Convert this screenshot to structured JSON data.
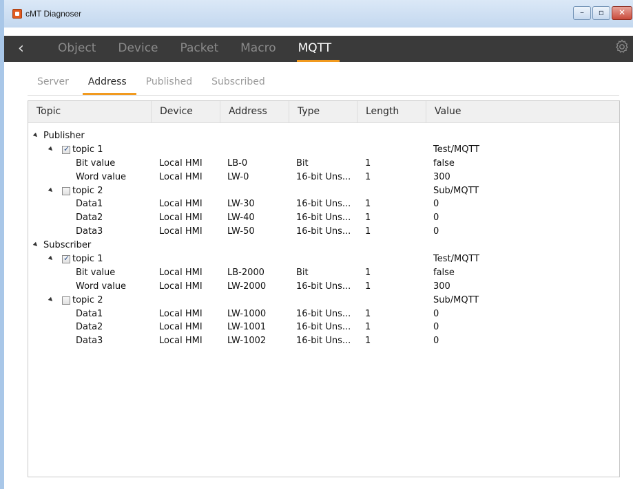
{
  "window": {
    "title": "cMT Diagnoser"
  },
  "nav": {
    "back_icon": "back-chevron-icon",
    "tabs": [
      {
        "label": "Object",
        "active": false
      },
      {
        "label": "Device",
        "active": false
      },
      {
        "label": "Packet",
        "active": false
      },
      {
        "label": "Macro",
        "active": false
      },
      {
        "label": "MQTT",
        "active": true
      }
    ],
    "settings_icon": "gear-icon"
  },
  "subtabs": [
    {
      "label": "Server",
      "active": false
    },
    {
      "label": "Address",
      "active": true
    },
    {
      "label": "Published",
      "active": false
    },
    {
      "label": "Subscribed",
      "active": false
    }
  ],
  "table": {
    "columns": [
      "Topic",
      "Device",
      "Address",
      "Type",
      "Length",
      "Value"
    ],
    "rows": [
      {
        "level": 0,
        "topic": "Publisher",
        "device": "",
        "address": "",
        "type": "",
        "length": "",
        "value": "",
        "expander": true
      },
      {
        "level": 1,
        "topic": "topic 1",
        "checkbox": true,
        "checked": true,
        "device": "",
        "address": "",
        "type": "",
        "length": "",
        "value": "Test/MQTT",
        "expander": true
      },
      {
        "level": 2,
        "topic": "Bit value",
        "device": "Local HMI",
        "address": "LB-0",
        "type": "Bit",
        "length": "1",
        "value": "false"
      },
      {
        "level": 2,
        "topic": "Word value",
        "device": "Local HMI",
        "address": "LW-0",
        "type": "16-bit Uns...",
        "length": "1",
        "value": "300"
      },
      {
        "level": 1,
        "topic": "topic 2",
        "checkbox": true,
        "checked": false,
        "device": "",
        "address": "",
        "type": "",
        "length": "",
        "value": "Sub/MQTT",
        "expander": true
      },
      {
        "level": 2,
        "topic": "Data1",
        "device": "Local HMI",
        "address": "LW-30",
        "type": "16-bit Uns...",
        "length": "1",
        "value": "0"
      },
      {
        "level": 2,
        "topic": "Data2",
        "device": "Local HMI",
        "address": "LW-40",
        "type": "16-bit Uns...",
        "length": "1",
        "value": "0"
      },
      {
        "level": 2,
        "topic": "Data3",
        "device": "Local HMI",
        "address": "LW-50",
        "type": "16-bit Uns...",
        "length": "1",
        "value": "0"
      },
      {
        "level": 0,
        "topic": "Subscriber",
        "device": "",
        "address": "",
        "type": "",
        "length": "",
        "value": "",
        "expander": true
      },
      {
        "level": 1,
        "topic": "topic 1",
        "checkbox": true,
        "checked": true,
        "device": "",
        "address": "",
        "type": "",
        "length": "",
        "value": "Test/MQTT",
        "expander": true
      },
      {
        "level": 2,
        "topic": "Bit value",
        "device": "Local HMI",
        "address": "LB-2000",
        "type": "Bit",
        "length": "1",
        "value": "false"
      },
      {
        "level": 2,
        "topic": "Word value",
        "device": "Local HMI",
        "address": "LW-2000",
        "type": "16-bit Uns...",
        "length": "1",
        "value": "300"
      },
      {
        "level": 1,
        "topic": "topic 2",
        "checkbox": true,
        "checked": false,
        "device": "",
        "address": "",
        "type": "",
        "length": "",
        "value": "Sub/MQTT",
        "expander": true
      },
      {
        "level": 2,
        "topic": "Data1",
        "device": "Local HMI",
        "address": "LW-1000",
        "type": "16-bit Uns...",
        "length": "1",
        "value": "0"
      },
      {
        "level": 2,
        "topic": "Data2",
        "device": "Local HMI",
        "address": "LW-1001",
        "type": "16-bit Uns...",
        "length": "1",
        "value": "0"
      },
      {
        "level": 2,
        "topic": "Data3",
        "device": "Local HMI",
        "address": "LW-1002",
        "type": "16-bit Uns...",
        "length": "1",
        "value": "0"
      }
    ]
  },
  "colors": {
    "accent": "#f19a1f",
    "navbar": "#3a3a3a"
  }
}
